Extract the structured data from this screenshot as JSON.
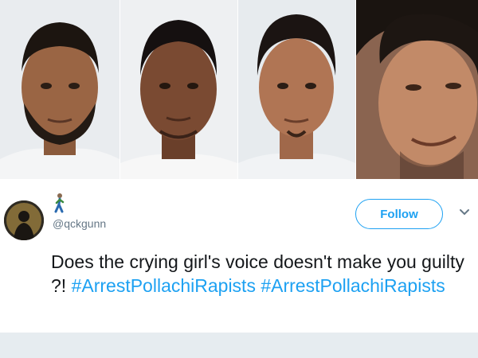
{
  "tweet": {
    "handle": "@qckgunn",
    "follow_label": "Follow",
    "text": "Does the crying girl's voice doesn't make you guilty ?!",
    "hashtags": [
      "#ArrestPollachiRapists",
      "#ArrestPollachiRapists"
    ]
  },
  "icons": [
    "walking-person-icon",
    "chevron-down-icon"
  ],
  "colors": {
    "link": "#1da1f2",
    "text": "#14171a",
    "secondary": "#657786",
    "band": "#e6ecf0"
  }
}
